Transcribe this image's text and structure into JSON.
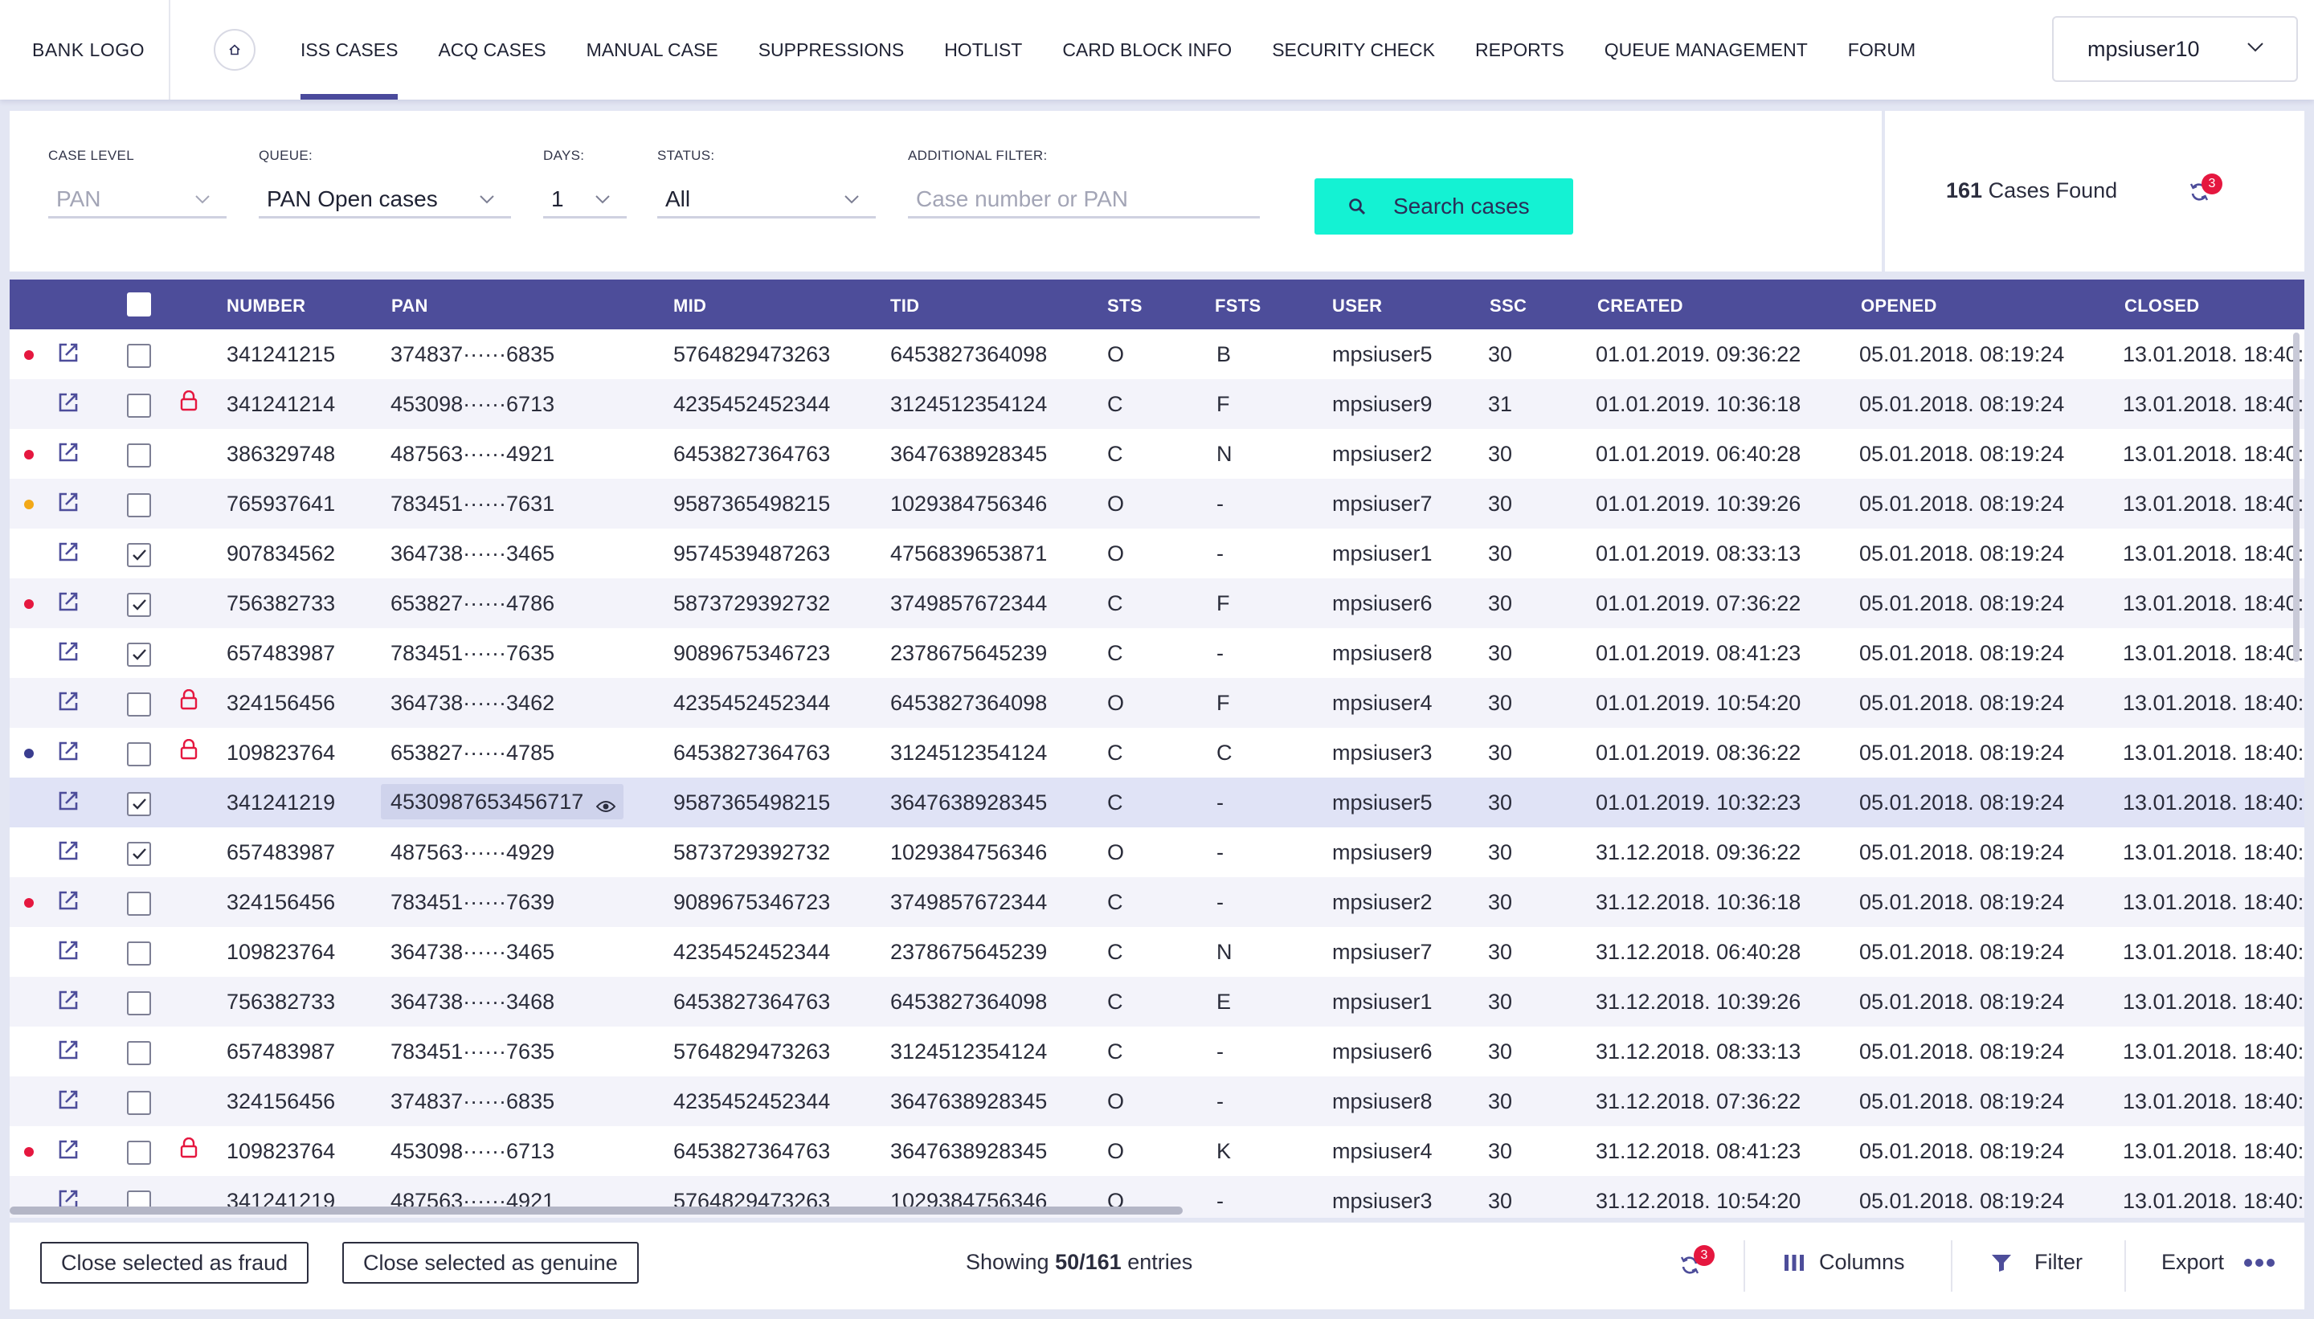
{
  "nav": {
    "logo": "BANK LOGO",
    "home_icon": "home-icon",
    "items": [
      {
        "label": "ISS CASES",
        "active": true
      },
      {
        "label": "ACQ CASES",
        "active": false
      },
      {
        "label": "MANUAL CASE",
        "active": false
      },
      {
        "label": "SUPPRESSIONS",
        "active": false
      },
      {
        "label": "HOTLIST",
        "active": false
      },
      {
        "label": "CARD BLOCK INFO",
        "active": false
      },
      {
        "label": "SECURITY CHECK",
        "active": false
      },
      {
        "label": "REPORTS",
        "active": false
      },
      {
        "label": "QUEUE MANAGEMENT",
        "active": false
      },
      {
        "label": "FORUM",
        "active": false
      }
    ],
    "user": "mpsiuser10"
  },
  "filters": {
    "case_level": {
      "label": "CASE LEVEL",
      "value": "PAN"
    },
    "queue": {
      "label": "QUEUE:",
      "value": "PAN Open cases"
    },
    "days": {
      "label": "DAYS:",
      "value": "1"
    },
    "status": {
      "label": "STATUS:",
      "value": "All"
    },
    "additional": {
      "label": "ADDITIONAL FILTER:",
      "placeholder": "Case number or PAN"
    },
    "search_button": "Search cases"
  },
  "results": {
    "count": "161",
    "label": "Cases Found",
    "refresh_badge": "3"
  },
  "table": {
    "columns": [
      "NUMBER",
      "PAN",
      "MID",
      "TID",
      "STS",
      "FSTS",
      "USER",
      "SSC",
      "CREATED",
      "OPENED",
      "CLOSED"
    ],
    "rows": [
      {
        "dot": "#e5173f",
        "checked": false,
        "lock": false,
        "number": "341241215",
        "pan": "374837······6835",
        "mid": "5764829473263",
        "tid": "6453827364098",
        "sts": "O",
        "fsts": "B",
        "user": "mpsiuser5",
        "ssc": "30",
        "created": "01.01.2019. 09:36:22",
        "opened": "05.01.2018. 08:19:24",
        "closed": "13.01.2018. 18:40:"
      },
      {
        "dot": "",
        "checked": false,
        "lock": true,
        "number": "341241214",
        "pan": "453098······6713",
        "mid": "4235452452344",
        "tid": "3124512354124",
        "sts": "C",
        "fsts": "F",
        "user": "mpsiuser9",
        "ssc": "31",
        "created": "01.01.2019. 10:36:18",
        "opened": "05.01.2018. 08:19:24",
        "closed": "13.01.2018. 18:40:"
      },
      {
        "dot": "#e5173f",
        "checked": false,
        "lock": false,
        "number": "386329748",
        "pan": "487563······4921",
        "mid": "6453827364763",
        "tid": "3647638928345",
        "sts": "C",
        "fsts": "N",
        "user": "mpsiuser2",
        "ssc": "30",
        "created": "01.01.2019. 06:40:28",
        "opened": "05.01.2018. 08:19:24",
        "closed": "13.01.2018. 18:40:"
      },
      {
        "dot": "#f2a818",
        "checked": false,
        "lock": false,
        "number": "765937641",
        "pan": "783451······7631",
        "mid": "9587365498215",
        "tid": "1029384756346",
        "sts": "O",
        "fsts": "-",
        "user": "mpsiuser7",
        "ssc": "30",
        "created": "01.01.2019. 10:39:26",
        "opened": "05.01.2018. 08:19:24",
        "closed": "13.01.2018. 18:40:"
      },
      {
        "dot": "",
        "checked": true,
        "lock": false,
        "number": "907834562",
        "pan": "364738······3465",
        "mid": "9574539487263",
        "tid": "4756839653871",
        "sts": "O",
        "fsts": "-",
        "user": "mpsiuser1",
        "ssc": "30",
        "created": "01.01.2019. 08:33:13",
        "opened": "05.01.2018. 08:19:24",
        "closed": "13.01.2018. 18:40:"
      },
      {
        "dot": "#e5173f",
        "checked": true,
        "lock": false,
        "number": "756382733",
        "pan": "653827······4786",
        "mid": "5873729392732",
        "tid": "3749857672344",
        "sts": "C",
        "fsts": "F",
        "user": "mpsiuser6",
        "ssc": "30",
        "created": "01.01.2019. 07:36:22",
        "opened": "05.01.2018. 08:19:24",
        "closed": "13.01.2018. 18:40:"
      },
      {
        "dot": "",
        "checked": true,
        "lock": false,
        "number": "657483987",
        "pan": "783451······7635",
        "mid": "9089675346723",
        "tid": "2378675645239",
        "sts": "C",
        "fsts": "-",
        "user": "mpsiuser8",
        "ssc": "30",
        "created": "01.01.2019. 08:41:23",
        "opened": "05.01.2018. 08:19:24",
        "closed": "13.01.2018. 18:40:"
      },
      {
        "dot": "",
        "checked": false,
        "lock": true,
        "number": "324156456",
        "pan": "364738······3462",
        "mid": "4235452452344",
        "tid": "6453827364098",
        "sts": "O",
        "fsts": "F",
        "user": "mpsiuser4",
        "ssc": "30",
        "created": "01.01.2019. 10:54:20",
        "opened": "05.01.2018. 08:19:24",
        "closed": "13.01.2018. 18:40:"
      },
      {
        "dot": "#3a3d8f",
        "checked": false,
        "lock": true,
        "number": "109823764",
        "pan": "653827······4785",
        "mid": "6453827364763",
        "tid": "3124512354124",
        "sts": "C",
        "fsts": "C",
        "user": "mpsiuser3",
        "ssc": "30",
        "created": "01.01.2019. 08:36:22",
        "opened": "05.01.2018. 08:19:24",
        "closed": "13.01.2018. 18:40:"
      },
      {
        "dot": "",
        "checked": true,
        "lock": false,
        "selected": true,
        "number": "341241219",
        "pan": "4530987653456717",
        "mid": "9587365498215",
        "tid": "3647638928345",
        "sts": "C",
        "fsts": "-",
        "user": "mpsiuser5",
        "ssc": "30",
        "created": "01.01.2019. 10:32:23",
        "opened": "05.01.2018. 08:19:24",
        "closed": "13.01.2018. 18:40:"
      },
      {
        "dot": "",
        "checked": true,
        "lock": false,
        "number": "657483987",
        "pan": "487563······4929",
        "mid": "5873729392732",
        "tid": "1029384756346",
        "sts": "O",
        "fsts": "-",
        "user": "mpsiuser9",
        "ssc": "30",
        "created": "31.12.2018. 09:36:22",
        "opened": "05.01.2018. 08:19:24",
        "closed": "13.01.2018. 18:40:"
      },
      {
        "dot": "#e5173f",
        "checked": false,
        "lock": false,
        "number": "324156456",
        "pan": "783451······7639",
        "mid": "9089675346723",
        "tid": "3749857672344",
        "sts": "C",
        "fsts": "-",
        "user": "mpsiuser2",
        "ssc": "30",
        "created": "31.12.2018. 10:36:18",
        "opened": "05.01.2018. 08:19:24",
        "closed": "13.01.2018. 18:40:"
      },
      {
        "dot": "",
        "checked": false,
        "lock": false,
        "number": "109823764",
        "pan": "364738······3465",
        "mid": "4235452452344",
        "tid": "2378675645239",
        "sts": "C",
        "fsts": "N",
        "user": "mpsiuser7",
        "ssc": "30",
        "created": "31.12.2018. 06:40:28",
        "opened": "05.01.2018. 08:19:24",
        "closed": "13.01.2018. 18:40:"
      },
      {
        "dot": "",
        "checked": false,
        "lock": false,
        "number": "756382733",
        "pan": "364738······3468",
        "mid": "6453827364763",
        "tid": "6453827364098",
        "sts": "C",
        "fsts": "E",
        "user": "mpsiuser1",
        "ssc": "30",
        "created": "31.12.2018. 10:39:26",
        "opened": "05.01.2018. 08:19:24",
        "closed": "13.01.2018. 18:40:"
      },
      {
        "dot": "",
        "checked": false,
        "lock": false,
        "number": "657483987",
        "pan": "783451······7635",
        "mid": "5764829473263",
        "tid": "3124512354124",
        "sts": "C",
        "fsts": "-",
        "user": "mpsiuser6",
        "ssc": "30",
        "created": "31.12.2018. 08:33:13",
        "opened": "05.01.2018. 08:19:24",
        "closed": "13.01.2018. 18:40:"
      },
      {
        "dot": "",
        "checked": false,
        "lock": false,
        "number": "324156456",
        "pan": "374837······6835",
        "mid": "4235452452344",
        "tid": "3647638928345",
        "sts": "O",
        "fsts": "-",
        "user": "mpsiuser8",
        "ssc": "30",
        "created": "31.12.2018. 07:36:22",
        "opened": "05.01.2018. 08:19:24",
        "closed": "13.01.2018. 18:40:"
      },
      {
        "dot": "#e5173f",
        "checked": false,
        "lock": true,
        "number": "109823764",
        "pan": "453098······6713",
        "mid": "6453827364763",
        "tid": "3647638928345",
        "sts": "O",
        "fsts": "K",
        "user": "mpsiuser4",
        "ssc": "30",
        "created": "31.12.2018. 08:41:23",
        "opened": "05.01.2018. 08:19:24",
        "closed": "13.01.2018. 18:40:"
      },
      {
        "dot": "",
        "checked": false,
        "lock": false,
        "number": "341241219",
        "pan": "487563······4921",
        "mid": "5764829473263",
        "tid": "1029384756346",
        "sts": "O",
        "fsts": "-",
        "user": "mpsiuser3",
        "ssc": "30",
        "created": "31.12.2018. 10:54:20",
        "opened": "05.01.2018. 08:19:24",
        "closed": "13.01.2018. 18:40:"
      }
    ]
  },
  "footer": {
    "close_fraud": "Close selected as fraud",
    "close_genuine": "Close selected as genuine",
    "showing_prefix": "Showing",
    "showing_count": "50/161",
    "showing_suffix": "entries",
    "refresh_badge": "3",
    "columns_label": "Columns",
    "filter_label": "Filter",
    "export_label": "Export"
  },
  "colors": {
    "accent": "#4d4d9a",
    "search": "#14f2d3",
    "alert_red": "#e5173f",
    "warning_orange": "#f2a818"
  }
}
